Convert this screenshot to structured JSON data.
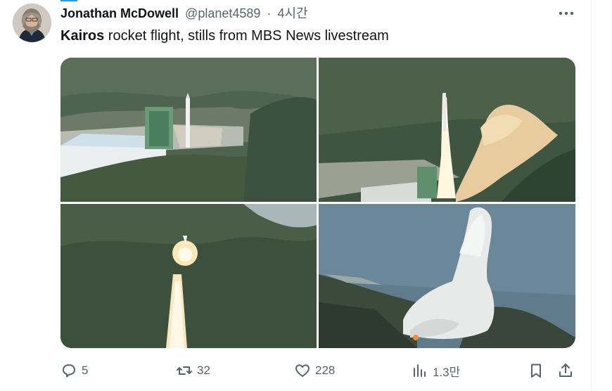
{
  "tweet": {
    "author_name": "Jonathan McDowell",
    "author_handle": "@planet4589",
    "separator": "·",
    "timestamp": "4시간",
    "text_bold": "Kairos",
    "text_rest": " rocket flight, stills from MBS News livestream"
  },
  "media": {
    "count": 4
  },
  "actions": {
    "replies": "5",
    "retweets": "32",
    "likes": "228",
    "views": "1.3만"
  },
  "colors": {
    "accent": "#1d9bf0",
    "secondary_text": "#536471",
    "primary_text": "#0f1419"
  }
}
